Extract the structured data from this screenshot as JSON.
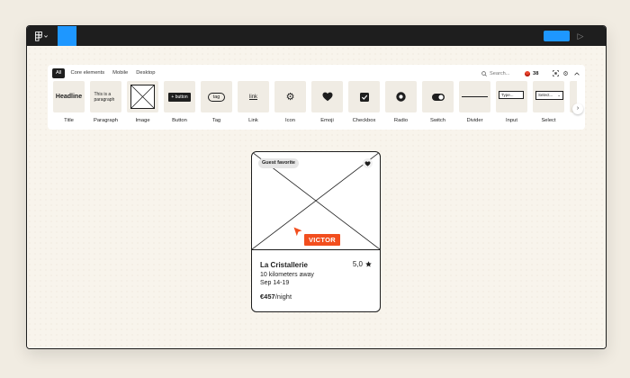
{
  "colors": {
    "accent": "#1e97ff",
    "collaborator": "#f24e1e",
    "topbar": "#1e1e1e"
  },
  "toolbar": {
    "menu_icon": "figma-logo-icon",
    "play_icon": "play-icon"
  },
  "panel": {
    "filters": [
      "All",
      "Core elements",
      "Mobile",
      "Desktop"
    ],
    "active_filter": "All",
    "search": {
      "placeholder": "Search..."
    },
    "count": "38",
    "tiles": [
      {
        "label": "Title",
        "preview": "Headline",
        "icon": "headline-text"
      },
      {
        "label": "Paragraph",
        "preview": "This is a paragraph",
        "icon": "paragraph-text"
      },
      {
        "label": "Image",
        "preview": "",
        "icon": "image-placeholder-icon"
      },
      {
        "label": "Button",
        "preview": "+ button",
        "icon": "button-preview"
      },
      {
        "label": "Tag",
        "preview": "tag",
        "icon": "tag-preview"
      },
      {
        "label": "Link",
        "preview": "link",
        "icon": "link-preview"
      },
      {
        "label": "Icon",
        "preview": "",
        "icon": "gear-icon"
      },
      {
        "label": "Emoji",
        "preview": "",
        "icon": "heart-icon"
      },
      {
        "label": "Checkbox",
        "preview": "",
        "icon": "checkbox-icon"
      },
      {
        "label": "Radio",
        "preview": "",
        "icon": "radio-icon"
      },
      {
        "label": "Switch",
        "preview": "",
        "icon": "switch-icon"
      },
      {
        "label": "Divider",
        "preview": "",
        "icon": "divider-icon"
      },
      {
        "label": "Input",
        "preview": "Type...",
        "icon": "input-preview"
      },
      {
        "label": "Select",
        "preview": "Select...",
        "icon": "select-preview"
      }
    ]
  },
  "card": {
    "badge": "Guest favorite",
    "title": "La Cristallerie",
    "rating": "5,0",
    "distance": "10 kilometers away",
    "dates": "Sep 14-19",
    "price": "€457",
    "price_unit": "/night"
  },
  "cursor": {
    "name": "VICTOR"
  }
}
